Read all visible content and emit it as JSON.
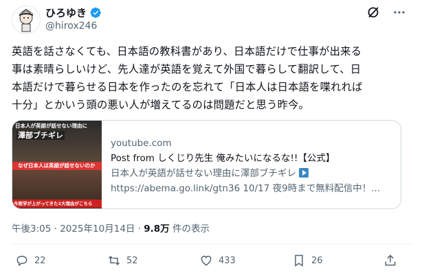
{
  "author": {
    "display_name": "ひろゆき",
    "handle": "@hirox246",
    "avatar_icon": "avatar-illustration",
    "verified_icon": "verified-badge-icon",
    "verified_color": "#1d9bf0"
  },
  "top_actions": {
    "grok_icon": "grok-icon",
    "more_icon": "more-options-icon"
  },
  "tweet": {
    "text": "英語を話さなくても、日本語の教科書があり、日本語だけで仕事が出来る\n事は素晴らしいけど、先人達が英語を覚えて外国で暮らして翻訳して、日\n本語だけで暮らせる日本を作ったのを忘れて「日本人は日本語を喋れれば\n十分」とかいう頭の悪い人が増えてるのは問題だと思う昨今。"
  },
  "card": {
    "thumb_caption_top": "日本人が英語が話せない理由に",
    "thumb_caption_name": "澤部ブチギレ",
    "thumb_caption_mid": "なぜ日本人は英語が話せないのか",
    "thumb_caption_bottom": "今医学が上がってきた2大理由がこちら",
    "domain": "youtube.com",
    "title": "Post from しくじり先生 俺みたいになるな!!【公式】",
    "desc_line1": "日本人が英語が話せない理由に澤部ブチギレ",
    "desc_line2": "https://abema.go.link/gtn36 10/17 夜9時まで無料配信中！..."
  },
  "meta": {
    "time": "午後3:05 · 2025年10月14日 · ",
    "views": "9.8万",
    "views_suffix": " 件の表示"
  },
  "action_bar": {
    "reply_count": "22",
    "repost_count": "52",
    "like_count": "433",
    "bookmark_count": "26"
  }
}
